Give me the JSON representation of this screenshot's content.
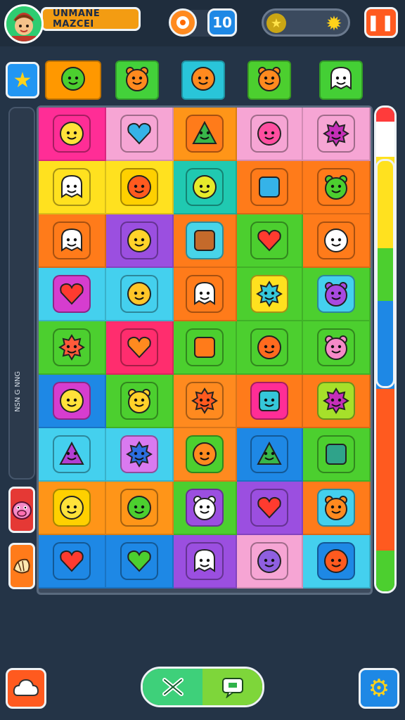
{
  "header": {
    "player_name": "UNMANE MAZCEI",
    "moves_count": "10",
    "pause_icon": "pause-icon",
    "coin_icon": "coin-icon",
    "star_icon": "star-icon",
    "avatar_icon": "player-avatar-icon"
  },
  "sidebar": {
    "label": "NSN G NNG",
    "buttons": [
      {
        "icon": "pig-face-icon",
        "color": "#e53935"
      },
      {
        "icon": "croissant-icon",
        "color": "#ff7b1a"
      }
    ]
  },
  "top_row": [
    {
      "icon": "green-blob-icon",
      "tile": "#ff9800"
    },
    {
      "icon": "orange-bear-icon",
      "tile": "#43d13a"
    },
    {
      "icon": "orange-face-icon",
      "tile": "#29c5d9"
    },
    {
      "icon": "orange-bear-icon",
      "tile": "#4ccf2f"
    },
    {
      "icon": "white-ghost-icon",
      "tile": "#44cf35"
    }
  ],
  "board": {
    "rows": [
      [
        {
          "icon": "yellow-smiley-icon",
          "bg": "#ff2d96",
          "icon_bg": "#ff2d96",
          "face": "#ffe23a"
        },
        {
          "icon": "blue-heart-icon",
          "bg": "#f6a5d4",
          "icon_bg": "#f6a5d4",
          "face": "#35b3e8"
        },
        {
          "icon": "green-triangle-icon",
          "bg": "#ff9518",
          "icon_bg": "#ff7b1a",
          "face": "#38b74a"
        },
        {
          "icon": "lightning-blob-icon",
          "bg": "#f6a5d4",
          "icon_bg": "#f6a5d4",
          "face": "#ff4fa0"
        },
        {
          "icon": "purple-fuzzy-icon",
          "bg": "#f6a5d4",
          "icon_bg": "#f6a5d4",
          "face": "#c52fb8"
        }
      ],
      [
        {
          "icon": "red-hat-ghost-icon",
          "bg": "#ffe11f",
          "icon_bg": "#ffe11f",
          "face": "#ffffff"
        },
        {
          "icon": "orange-face-icon",
          "bg": "#ffe11f",
          "icon_bg": "#ffd000",
          "face": "#ff5a1f"
        },
        {
          "icon": "yellow-pear-icon",
          "bg": "#20c9b1",
          "icon_bg": "#20c9b1",
          "face": "#e6ea2b"
        },
        {
          "icon": "blue-square-icon",
          "bg": "#ff7b1a",
          "icon_bg": "#ff7b1a",
          "face": "#35b3e8"
        },
        {
          "icon": "green-bear-icon",
          "bg": "#ff7b1a",
          "icon_bg": "#ff7b1a",
          "face": "#4ccf2f"
        }
      ],
      [
        {
          "icon": "white-crown-icon",
          "bg": "#ff7b1a",
          "icon_bg": "#ff7b1a",
          "face": "#ffffff"
        },
        {
          "icon": "yellow-smiley-icon",
          "bg": "#9b4fe0",
          "icon_bg": "#9b4fe0",
          "face": "#ffd32a"
        },
        {
          "icon": "brown-box-icon",
          "bg": "#ff7b1a",
          "icon_bg": "#48d4e8",
          "face": "#c46a2b"
        },
        {
          "icon": "red-heart-icon",
          "bg": "#4ccf2f",
          "icon_bg": "#4ccf2f",
          "face": "#ff3b2f"
        },
        {
          "icon": "white-blob-icon",
          "bg": "#ff7b1a",
          "icon_bg": "#ff7b1a",
          "face": "#ffffff"
        }
      ],
      [
        {
          "icon": "red-heart-icon",
          "bg": "#44d0ee",
          "icon_bg": "#d63dcf",
          "face": "#ff3b2f"
        },
        {
          "icon": "yellow-bird-icon",
          "bg": "#44d0ee",
          "icon_bg": "#44d0ee",
          "face": "#ffc629"
        },
        {
          "icon": "red-hat-ghost-icon",
          "bg": "#ff7b1a",
          "icon_bg": "#ff7b1a",
          "face": "#ffffff"
        },
        {
          "icon": "cyan-spiky-icon",
          "bg": "#4ccf2f",
          "icon_bg": "#ffe11f",
          "face": "#35c7d9"
        },
        {
          "icon": "purple-cat-icon",
          "bg": "#4ccf2f",
          "icon_bg": "#44d0ee",
          "face": "#a84ae0"
        }
      ],
      [
        {
          "icon": "red-star-icon",
          "bg": "#4ccf2f",
          "icon_bg": "#4ccf2f",
          "face": "#ff5a3a"
        },
        {
          "icon": "orange-heart-icon",
          "bg": "#ff2d6e",
          "icon_bg": "#ff2d6e",
          "face": "#ff8a1f"
        },
        {
          "icon": "orange-bag-icon",
          "bg": "#4ccf2f",
          "icon_bg": "#4ccf2f",
          "face": "#ff7b1a"
        },
        {
          "icon": "orange-strawberry-icon",
          "bg": "#4ccf2f",
          "icon_bg": "#4ccf2f",
          "face": "#ff6a1f"
        },
        {
          "icon": "pink-bear-icon",
          "bg": "#4ccf2f",
          "icon_bg": "#4ccf2f",
          "face": "#f58ac8"
        }
      ],
      [
        {
          "icon": "yellow-smiley-icon",
          "bg": "#1e88e5",
          "icon_bg": "#d63dcf",
          "face": "#ffe23a"
        },
        {
          "icon": "yellow-cat-icon",
          "bg": "#4ccf2f",
          "icon_bg": "#4ccf2f",
          "face": "#ffd12a"
        },
        {
          "icon": "red-star-icon",
          "bg": "#ff8a1f",
          "icon_bg": "#ff8a1f",
          "face": "#ff5a1f"
        },
        {
          "icon": "cyan-shirt-icon",
          "bg": "#ff7b1a",
          "icon_bg": "#ff2d96",
          "face": "#35c7d9"
        },
        {
          "icon": "purple-fuzzy-icon",
          "bg": "#ff7b1a",
          "icon_bg": "#a6e02a",
          "face": "#c52fb8"
        }
      ],
      [
        {
          "icon": "purple-triangle-icon",
          "bg": "#44d0ee",
          "icon_bg": "#44d0ee",
          "face": "#b33fd3"
        },
        {
          "icon": "blue-gear-icon",
          "bg": "#44d0ee",
          "icon_bg": "#d97af0",
          "face": "#2c6ee0"
        },
        {
          "icon": "orange-face-icon",
          "bg": "#ff8a1f",
          "icon_bg": "#4ccf2f",
          "face": "#ff8a1f"
        },
        {
          "icon": "green-triangle-icon",
          "bg": "#1e88e5",
          "icon_bg": "#1e88e5",
          "face": "#38b74a"
        },
        {
          "icon": "teal-tablet-icon",
          "bg": "#4ccf2f",
          "icon_bg": "#4ccf2f",
          "face": "#2fa38a"
        }
      ],
      [
        {
          "icon": "yellow-smiley-icon",
          "bg": "#ff9518",
          "icon_bg": "#ffd000",
          "face": "#ffe23a"
        },
        {
          "icon": "green-blob-icon",
          "bg": "#ff9518",
          "icon_bg": "#ff9518",
          "face": "#4ccf2f"
        },
        {
          "icon": "white-bear-icon",
          "bg": "#4ccf2f",
          "icon_bg": "#9b4fe0",
          "face": "#ffffff"
        },
        {
          "icon": "red-heart-icon",
          "bg": "#9b4fe0",
          "icon_bg": "#9b4fe0",
          "face": "#ff3b2f"
        },
        {
          "icon": "orange-bear-icon",
          "bg": "#ff7b1a",
          "icon_bg": "#44d0ee",
          "face": "#ff8a1f"
        }
      ],
      [
        {
          "icon": "red-heart-icon",
          "bg": "#1e88e5",
          "icon_bg": "#1e88e5",
          "face": "#ff3b2f"
        },
        {
          "icon": "green-heart-icon",
          "bg": "#1e88e5",
          "icon_bg": "#1e88e5",
          "face": "#4ccf2f"
        },
        {
          "icon": "white-ghost-icon",
          "bg": "#9b4fe0",
          "icon_bg": "#9b4fe0",
          "face": "#ffffff"
        },
        {
          "icon": "purple-blob-icon",
          "bg": "#f6a5d4",
          "icon_bg": "#f6a5d4",
          "face": "#8f5fe0"
        },
        {
          "icon": "orange-face-icon",
          "bg": "#44d0ee",
          "icon_bg": "#1e88e5",
          "face": "#ff5a1f"
        }
      ]
    ]
  },
  "progress": {
    "segments": [
      "#ff3b3b",
      "#ffffff",
      "#ffe11f",
      "#4ccf2f",
      "#1e88e5",
      "#ff5a1f",
      "#4ccf2f"
    ]
  },
  "bottom": {
    "left_icon": "cloud-star-icon",
    "center_left_icon": "shuffle-icon",
    "center_right_icon": "chat-icon",
    "right_icon": "settings-gear-icon"
  }
}
